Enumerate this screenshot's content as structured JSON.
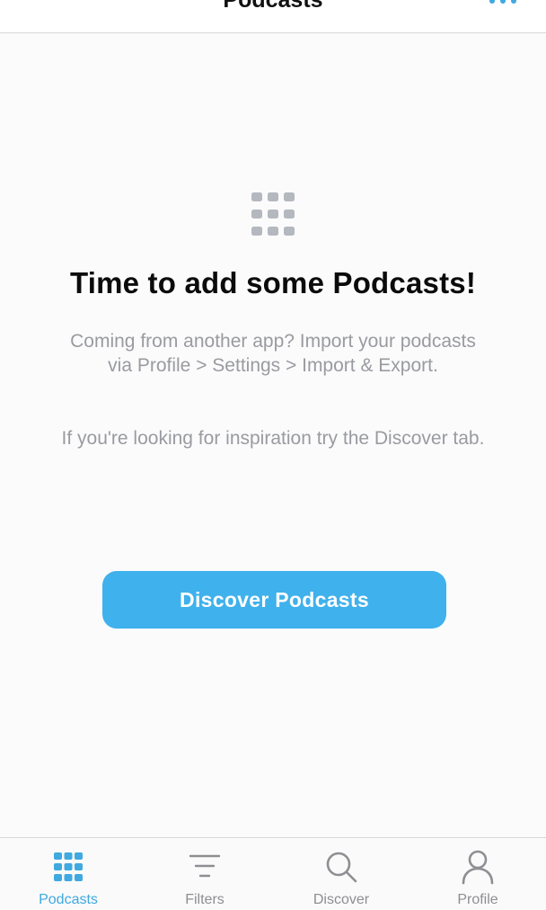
{
  "header": {
    "title": "Podcasts",
    "more_icon": "more-icon"
  },
  "empty_state": {
    "icon": "grid-icon",
    "title": "Time to add some Podcasts!",
    "description_line1": "Coming from another app? Import your podcasts",
    "description_line2": "via Profile > Settings > Import & Export.",
    "hint": "If you're looking for inspiration try the Discover tab.",
    "button_label": "Discover Podcasts"
  },
  "tabs": [
    {
      "label": "Podcasts",
      "icon": "grid-icon",
      "active": true
    },
    {
      "label": "Filters",
      "icon": "filter-icon",
      "active": false
    },
    {
      "label": "Discover",
      "icon": "search-icon",
      "active": false
    },
    {
      "label": "Profile",
      "icon": "profile-icon",
      "active": false
    }
  ],
  "colors": {
    "accent": "#3fb1ec",
    "tab_active": "#3fa9e0",
    "tab_inactive": "#8e8e93",
    "muted_text": "#9a9ba0",
    "icon_gray": "#b4b8bf"
  }
}
